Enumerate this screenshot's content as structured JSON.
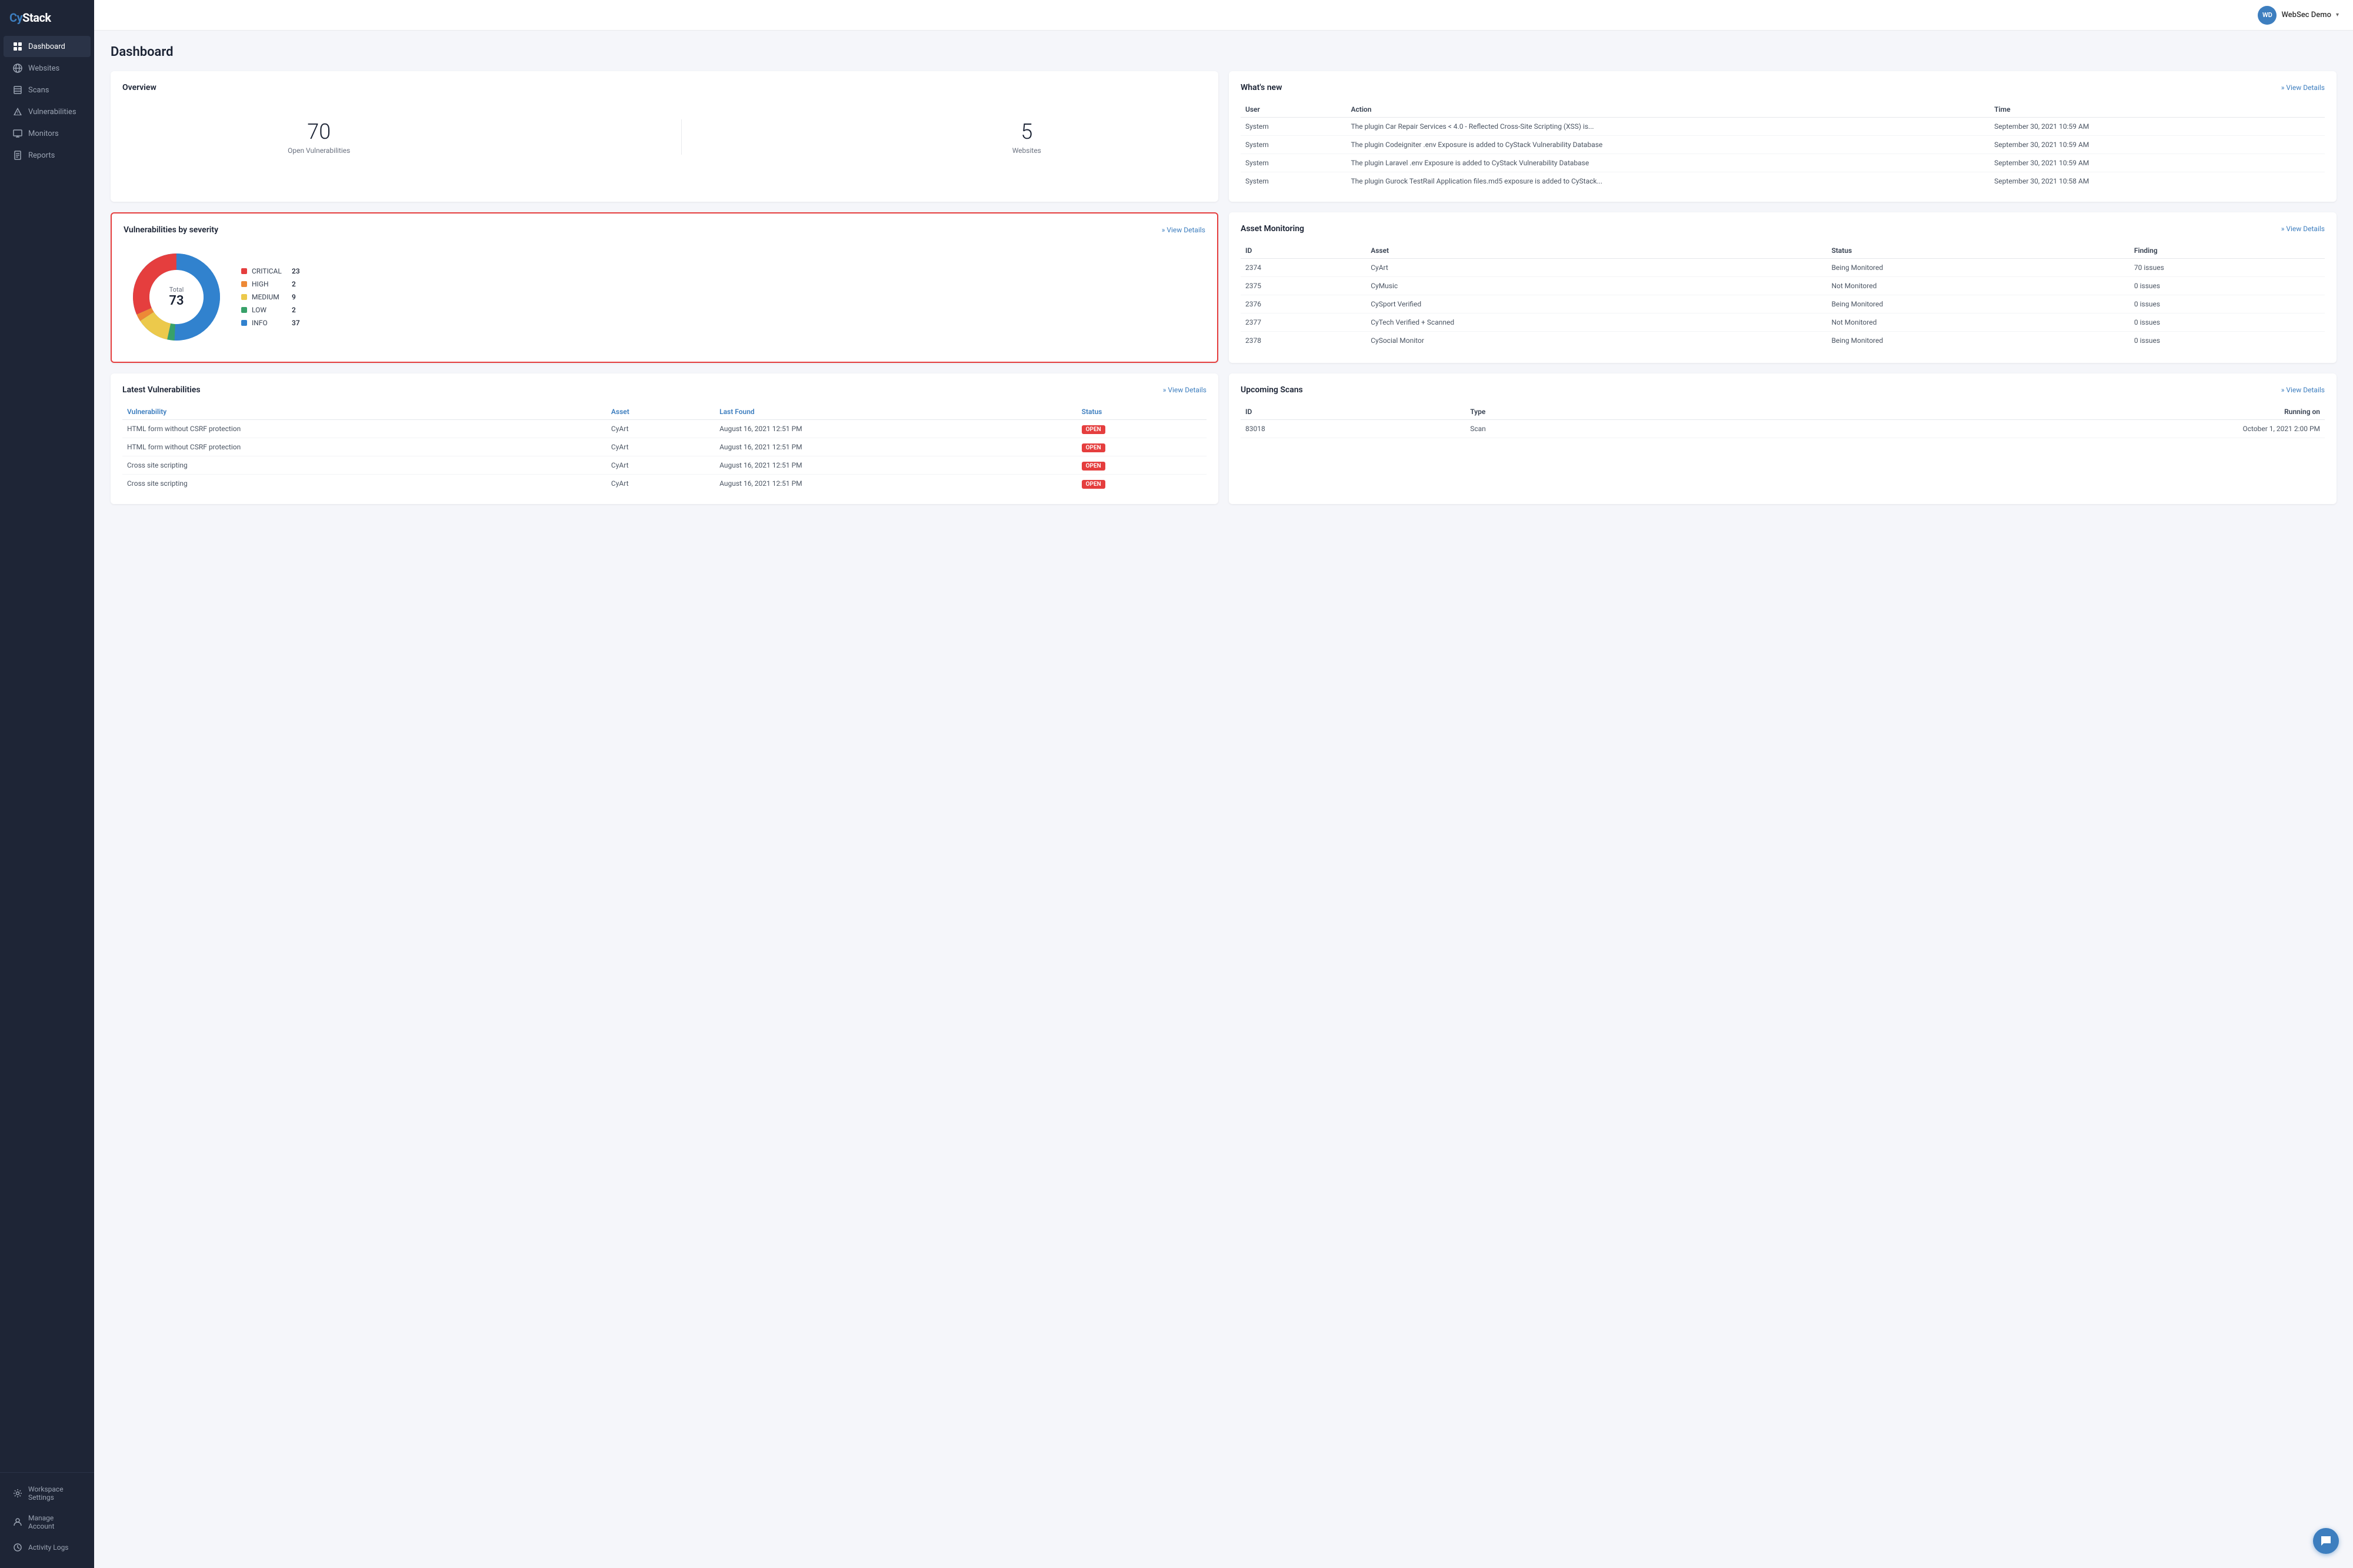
{
  "sidebar": {
    "logo": "CyStack",
    "logo_cy": "Cy",
    "logo_stack": "Stack",
    "nav_items": [
      {
        "id": "dashboard",
        "label": "Dashboard",
        "active": true
      },
      {
        "id": "websites",
        "label": "Websites",
        "active": false
      },
      {
        "id": "scans",
        "label": "Scans",
        "active": false
      },
      {
        "id": "vulnerabilities",
        "label": "Vulnerabilities",
        "active": false
      },
      {
        "id": "monitors",
        "label": "Monitors",
        "active": false
      },
      {
        "id": "reports",
        "label": "Reports",
        "active": false
      }
    ],
    "bottom_items": [
      {
        "id": "workspace-settings",
        "label": "Workspace Settings"
      },
      {
        "id": "manage-account",
        "label": "Manage Account"
      },
      {
        "id": "activity-logs",
        "label": "Activity Logs"
      }
    ]
  },
  "topbar": {
    "user_initials": "WD",
    "user_name": "WebSec Demo",
    "chevron": "▾"
  },
  "page_title": "Dashboard",
  "overview": {
    "title": "Overview",
    "open_vulnerabilities_count": "70",
    "open_vulnerabilities_label": "Open Vulnerabilities",
    "websites_count": "5",
    "websites_label": "Websites"
  },
  "whats_new": {
    "title": "What's new",
    "view_details": "» View Details",
    "columns": [
      "User",
      "Action",
      "Time"
    ],
    "rows": [
      {
        "user": "System",
        "action": "The plugin Car Repair Services < 4.0 - Reflected Cross-Site Scripting (XSS) is...",
        "time": "September 30, 2021 10:59 AM"
      },
      {
        "user": "System",
        "action": "The plugin Codeigniter .env Exposure is added to CyStack Vulnerability Database",
        "time": "September 30, 2021 10:59 AM"
      },
      {
        "user": "System",
        "action": "The plugin Laravel .env Exposure is added to CyStack Vulnerability Database",
        "time": "September 30, 2021 10:59 AM"
      },
      {
        "user": "System",
        "action": "The plugin Gurock TestRail Application files.md5 exposure is added to CyStack...",
        "time": "September 30, 2021 10:58 AM"
      }
    ]
  },
  "vulnerabilities_severity": {
    "title": "Vulnerabilities by severity",
    "view_details": "» View Details",
    "total_label": "Total",
    "total": "73",
    "legend": [
      {
        "name": "CRITICAL",
        "count": 23,
        "color": "#e53e3e"
      },
      {
        "name": "HIGH",
        "count": 2,
        "color": "#ed8936"
      },
      {
        "name": "MEDIUM",
        "count": 9,
        "color": "#ecc94b"
      },
      {
        "name": "LOW",
        "count": 2,
        "color": "#38a169"
      },
      {
        "name": "INFO",
        "count": 37,
        "color": "#3182ce"
      }
    ],
    "donut": {
      "critical_pct": 31.5,
      "high_pct": 2.7,
      "medium_pct": 12.3,
      "low_pct": 2.7,
      "info_pct": 50.7
    }
  },
  "asset_monitoring": {
    "title": "Asset Monitoring",
    "view_details": "» View Details",
    "columns": [
      "ID",
      "Asset",
      "Status",
      "Finding"
    ],
    "rows": [
      {
        "id": "2374",
        "asset": "CyArt",
        "status": "Being Monitored",
        "finding": "70 issues"
      },
      {
        "id": "2375",
        "asset": "CyMusic",
        "status": "Not Monitored",
        "finding": "0 issues"
      },
      {
        "id": "2376",
        "asset": "CySport Verified",
        "status": "Being Monitored",
        "finding": "0 issues"
      },
      {
        "id": "2377",
        "asset": "CyTech Verified + Scanned",
        "status": "Not Monitored",
        "finding": "0 issues"
      },
      {
        "id": "2378",
        "asset": "CySocial Monitor",
        "status": "Being Monitored",
        "finding": "0 issues"
      }
    ]
  },
  "latest_vulnerabilities": {
    "title": "Latest Vulnerabilities",
    "view_details": "» View Details",
    "columns": [
      "Vulnerability",
      "Asset",
      "Last Found",
      "Status"
    ],
    "rows": [
      {
        "name": "HTML form without CSRF protection",
        "asset": "CyArt",
        "last_found": "August 16, 2021 12:51 PM",
        "status": "OPEN"
      },
      {
        "name": "HTML form without CSRF protection",
        "asset": "CyArt",
        "last_found": "August 16, 2021 12:51 PM",
        "status": "OPEN"
      },
      {
        "name": "Cross site scripting",
        "asset": "CyArt",
        "last_found": "August 16, 2021 12:51 PM",
        "status": "OPEN"
      },
      {
        "name": "Cross site scripting",
        "asset": "CyArt",
        "last_found": "August 16, 2021 12:51 PM",
        "status": "OPEN"
      }
    ]
  },
  "upcoming_scans": {
    "title": "Upcoming Scans",
    "view_details": "» View Details",
    "columns": [
      "ID",
      "Type",
      "Running on"
    ],
    "rows": [
      {
        "id": "83018",
        "type": "Scan",
        "running_on": "October 1, 2021 2:00 PM"
      }
    ]
  }
}
